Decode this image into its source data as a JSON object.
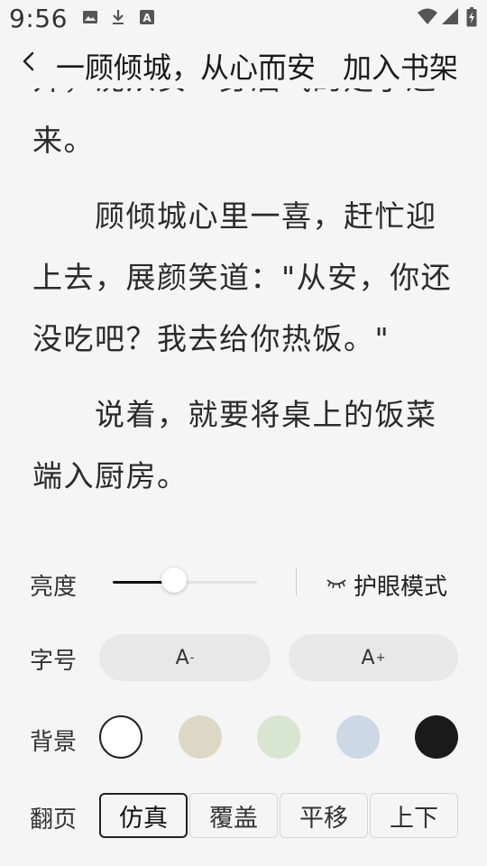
{
  "status_bar": {
    "time": "9:56",
    "icons_left": [
      "image-icon",
      "download-icon",
      "a-notification-icon"
    ],
    "icons_right": [
      "wifi-icon",
      "signal-icon",
      "battery-icon"
    ]
  },
  "header": {
    "back_icon": "chevron-left-icon",
    "book_title": "一顾倾城，从心而安",
    "add_to_shelf": "加入书架"
  },
  "reader": {
    "paragraphs": [
      {
        "lines": [
          "开，沈从安一身酒气的走了进",
          "来。"
        ]
      },
      {
        "lines": [
          "　　顾倾城心里一喜，赶忙迎",
          "上去，展颜笑道：\"从安，你还",
          "没吃吧？我去给你热饭。\""
        ]
      },
      {
        "lines": [
          "　　说着，就要将桌上的饭菜",
          "端入厨房。"
        ]
      }
    ]
  },
  "settings": {
    "brightness": {
      "label": "亮度",
      "level": 0.4
    },
    "eye_mode": {
      "icon": "closed-eye-icon",
      "label": "护眼模式"
    },
    "font_size": {
      "label": "字号",
      "decrease": "A",
      "decrease_sup": "-",
      "increase": "A",
      "increase_sup": "+"
    },
    "background": {
      "label": "背景",
      "colors": [
        "#ffffff",
        "#ddd7c6",
        "#d8e5d0",
        "#ccd8e6",
        "#1a1a1a"
      ],
      "selected_index": 0
    },
    "page_turn": {
      "label": "翻页",
      "options": [
        "仿真",
        "覆盖",
        "平移",
        "上下"
      ],
      "selected_index": 0
    }
  }
}
